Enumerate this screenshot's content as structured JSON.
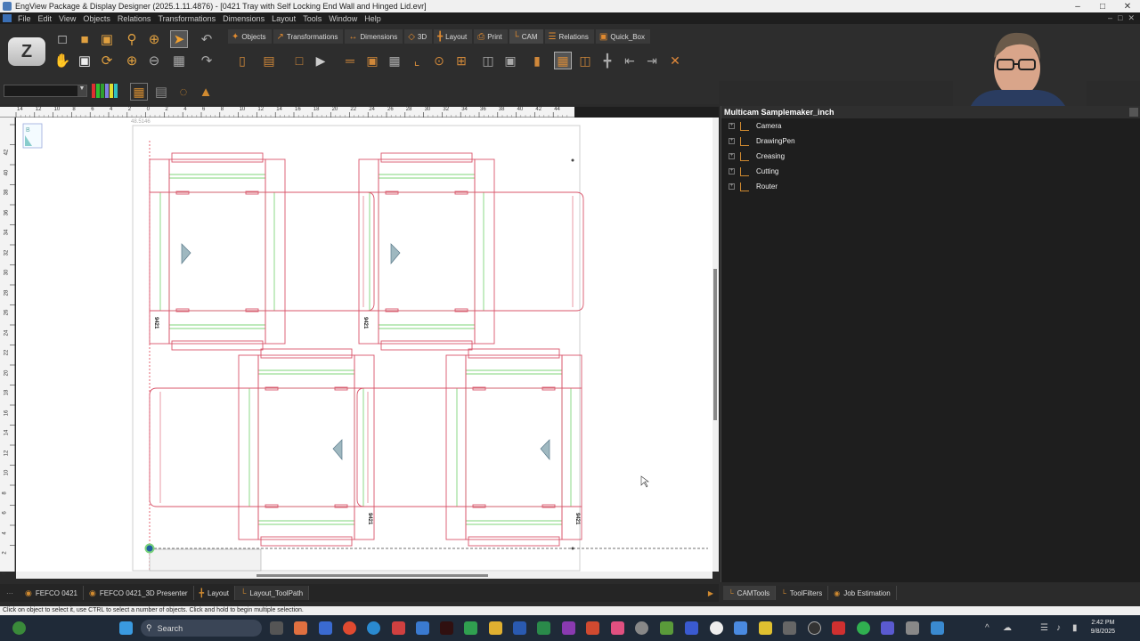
{
  "window": {
    "title": "EngView Package & Display Designer (2025.1.11.4876) - [0421 Tray with Self Locking End Wall and Hinged Lid.evr]",
    "minimize": "–",
    "maximize": "□",
    "close": "✕"
  },
  "menu": [
    "File",
    "Edit",
    "View",
    "Objects",
    "Relations",
    "Transformations",
    "Dimensions",
    "Layout",
    "Tools",
    "Window",
    "Help"
  ],
  "logo_text": "Z",
  "tabs": [
    {
      "label": "Objects",
      "icon": "✦"
    },
    {
      "label": "Transformations",
      "icon": "↗"
    },
    {
      "label": "Dimensions",
      "icon": "↔"
    },
    {
      "label": "3D",
      "icon": "◇"
    },
    {
      "label": "Layout",
      "icon": "╋"
    },
    {
      "label": "Print",
      "icon": "⎙"
    },
    {
      "label": "CAM",
      "icon": "└"
    },
    {
      "label": "Relations",
      "icon": "☰"
    },
    {
      "label": "Quick_Box",
      "icon": "▣"
    }
  ],
  "ruler": {
    "h_labels": [
      "14",
      "12",
      "10",
      "8",
      "6",
      "4",
      "2",
      "0",
      "2",
      "4",
      "6",
      "8",
      "10",
      "12",
      "14",
      "16",
      "18",
      "20",
      "22",
      "24",
      "26",
      "28",
      "30",
      "32",
      "34",
      "36",
      "38",
      "40",
      "42",
      "44"
    ],
    "v_labels": [
      "42",
      "40",
      "38",
      "36",
      "34",
      "32",
      "30",
      "28",
      "26",
      "24",
      "22",
      "20",
      "18",
      "16",
      "14",
      "12",
      "10",
      "8",
      "6",
      "4",
      "2",
      "0"
    ]
  },
  "canvas": {
    "corner_label": "48.5146",
    "stamp": "9421",
    "thumb_label": "B"
  },
  "panel": {
    "title": "Multicam Samplemaker_inch",
    "items": [
      "Camera",
      "DrawingPen",
      "Creasing",
      "Cutting",
      "Router"
    ]
  },
  "doc_tabs": [
    "FEFCO 0421",
    "FEFCO 0421_3D Presenter",
    "Layout",
    "Layout_ToolPath"
  ],
  "panel_tabs": [
    "CAMTools",
    "ToolFilters",
    "Job Estimation"
  ],
  "status": "Click on object to select it, use CTRL to select a number of objects. Click and hold to begin multiple selection.",
  "taskbar": {
    "search_placeholder": "Search",
    "time": "2:42 PM",
    "date": "9/8/2025"
  },
  "colors": {
    "cut_line": "#d9546a",
    "crease_line": "#7fd67a",
    "accent": "#d08a30"
  }
}
